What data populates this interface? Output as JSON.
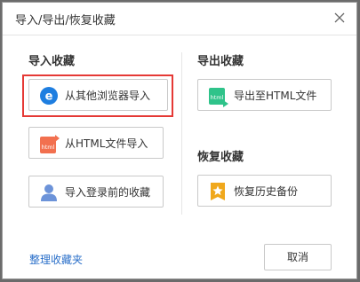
{
  "dialog": {
    "title": "导入/导出/恢复收藏"
  },
  "import": {
    "section_title": "导入收藏",
    "from_browser_label": "从其他浏览器导入",
    "from_html_label": "从HTML文件导入",
    "from_login_label": "导入登录前的收藏"
  },
  "export": {
    "section_title": "导出收藏",
    "to_html_label": "导出至HTML文件"
  },
  "restore": {
    "section_title": "恢复收藏",
    "history_backup_label": "恢复历史备份"
  },
  "footer": {
    "organize_link": "整理收藏夹",
    "cancel_label": "取消"
  },
  "icons": {
    "html_badge": "html",
    "browser_letter": "e"
  },
  "colors": {
    "browser_icon": "#1e7ee0",
    "html_import_icon": "#f2704f",
    "html_export_icon": "#2fc38a",
    "user_icon": "#6c93d9",
    "backup_icon": "#f0a81c",
    "highlight": "#e53935",
    "link": "#2a6fc9"
  }
}
